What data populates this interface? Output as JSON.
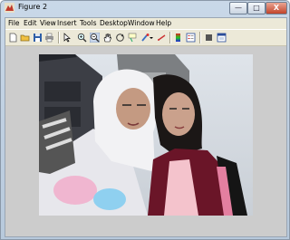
{
  "window": {
    "title": "Figure 2"
  },
  "window_controls": {
    "minimize": "—",
    "maximize": "□",
    "close": "X"
  },
  "menu": [
    "File",
    "Edit",
    "View",
    "Insert",
    "Tools",
    "Desktop",
    "Window",
    "Help"
  ],
  "toolbar": {
    "icons": [
      "new-figure-icon",
      "open-file-icon",
      "save-icon",
      "print-icon",
      "arrow-select-icon",
      "zoom-in-icon",
      "zoom-out-icon",
      "pan-hand-icon",
      "rotate-3d-icon",
      "data-cursor-icon",
      "brush-icon",
      "link-icon",
      "colorbar-icon",
      "legend-icon",
      "hide-plot-tools-icon",
      "show-plot-tools-icon"
    ]
  },
  "figure": {
    "content": "photograph"
  },
  "colors": {
    "figure_background": "#cccccc",
    "window_frame": "#c9d8e8",
    "client_background": "#ece9d8"
  }
}
